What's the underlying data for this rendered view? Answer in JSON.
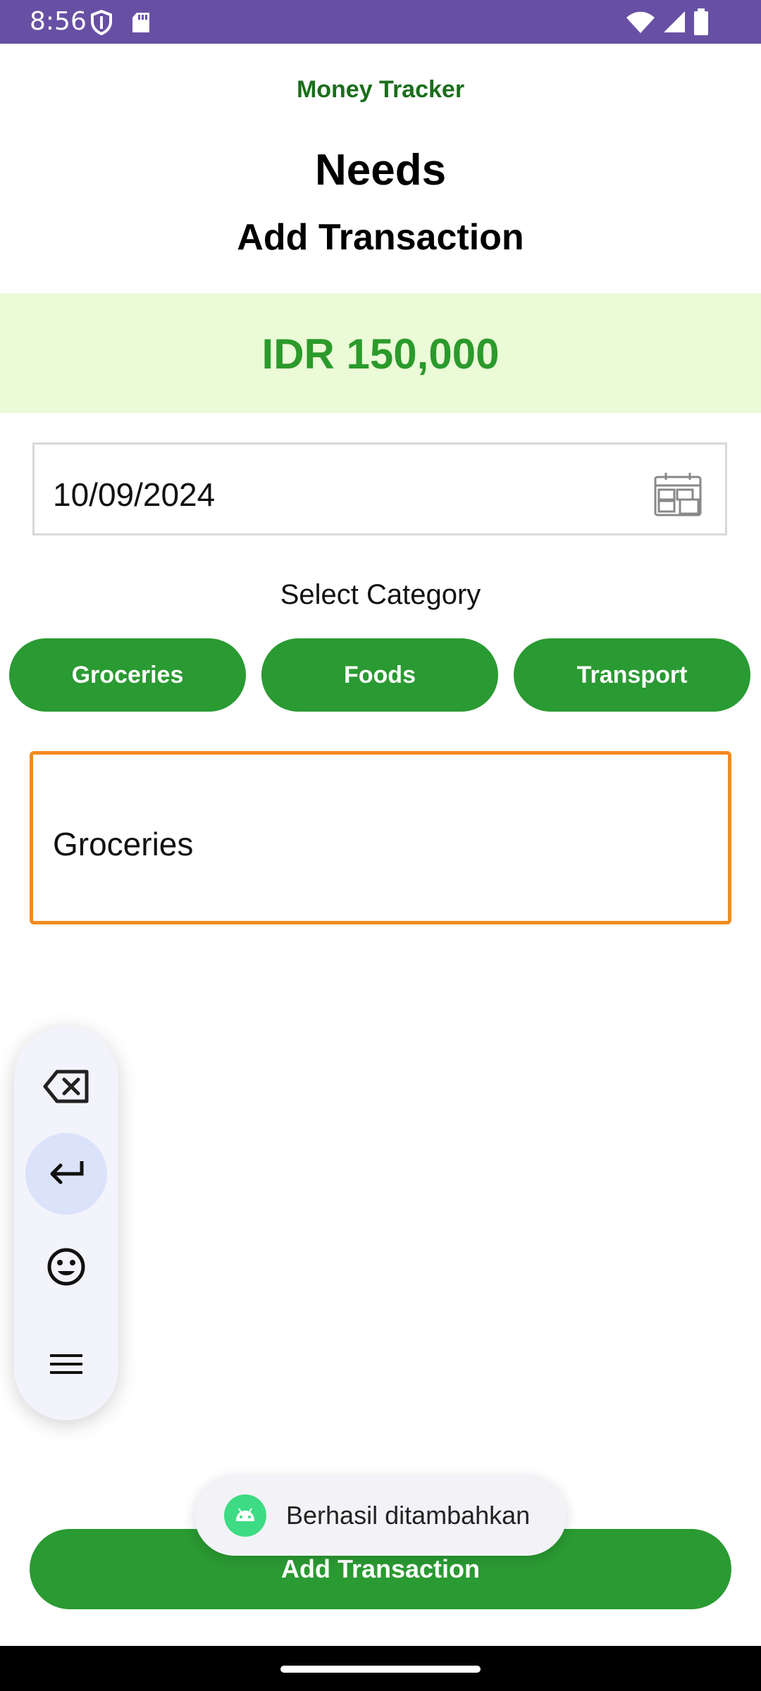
{
  "status_bar": {
    "time": "8:56",
    "icons_left": [
      "shield-icon",
      "sd-card-icon"
    ],
    "icons_right": [
      "wifi-icon",
      "signal-icon",
      "battery-icon"
    ],
    "background": "#6750a4"
  },
  "header": {
    "app_title": "Money Tracker",
    "page_title": "Needs",
    "subtitle": "Add Transaction"
  },
  "amount": {
    "text": "IDR 150,000",
    "color": "#2b9a2b",
    "banner_color": "#ebfad7"
  },
  "date_field": {
    "value": "10/09/2024",
    "icon": "calendar-icon"
  },
  "category": {
    "label": "Select Category",
    "chips": [
      {
        "label": "Groceries"
      },
      {
        "label": "Foods"
      },
      {
        "label": "Transport"
      }
    ],
    "chip_color": "#2a9a32"
  },
  "note_input": {
    "value": "Groceries",
    "border_color": "#f28a1e"
  },
  "keyboard_toolbar": {
    "buttons": [
      "backspace-icon",
      "enter-icon",
      "emoji-icon",
      "menu-icon"
    ],
    "active": "enter-icon"
  },
  "toast": {
    "text": "Berhasil ditambahkan",
    "icon": "android-icon"
  },
  "actions": {
    "add_label": "Add Transaction"
  }
}
